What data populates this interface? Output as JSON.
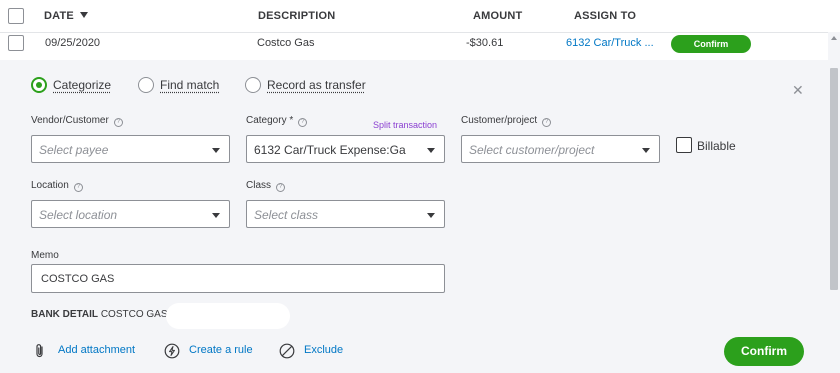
{
  "table_header": {
    "date": "DATE",
    "description": "DESCRIPTION",
    "amount": "AMOUNT",
    "assign_to": "ASSIGN TO"
  },
  "transaction": {
    "date": "09/25/2020",
    "description": "Costco Gas",
    "amount": "-$30.61",
    "assign_to": "6132 Car/Truck ...",
    "confirm_label": "Confirm"
  },
  "mode": {
    "categorize": "Categorize",
    "find_match": "Find match",
    "record_transfer": "Record as transfer",
    "selected": "categorize"
  },
  "form": {
    "vendor_label": "Vendor/Customer",
    "vendor_placeholder": "Select payee",
    "category_label": "Category *",
    "category_value": "6132 Car/Truck Expense:Ga",
    "split_transaction": "Split transaction",
    "customer_label": "Customer/project",
    "customer_placeholder": "Select customer/project",
    "billable_label": "Billable",
    "billable_checked": false,
    "location_label": "Location",
    "location_placeholder": "Select location",
    "class_label": "Class",
    "class_placeholder": "Select class",
    "memo_label": "Memo",
    "memo_value": "COSTCO GAS"
  },
  "bank_detail": {
    "label": "BANK DETAIL",
    "value": "COSTCO GAS"
  },
  "actions": {
    "add_attachment": "Add attachment",
    "create_rule": "Create a rule",
    "exclude": "Exclude",
    "confirm": "Confirm"
  },
  "colors": {
    "brand_green": "#2ca01c",
    "link_blue": "#0077c5",
    "split_purple": "#8a3fd1",
    "panel_bg": "#f4f5f8"
  }
}
